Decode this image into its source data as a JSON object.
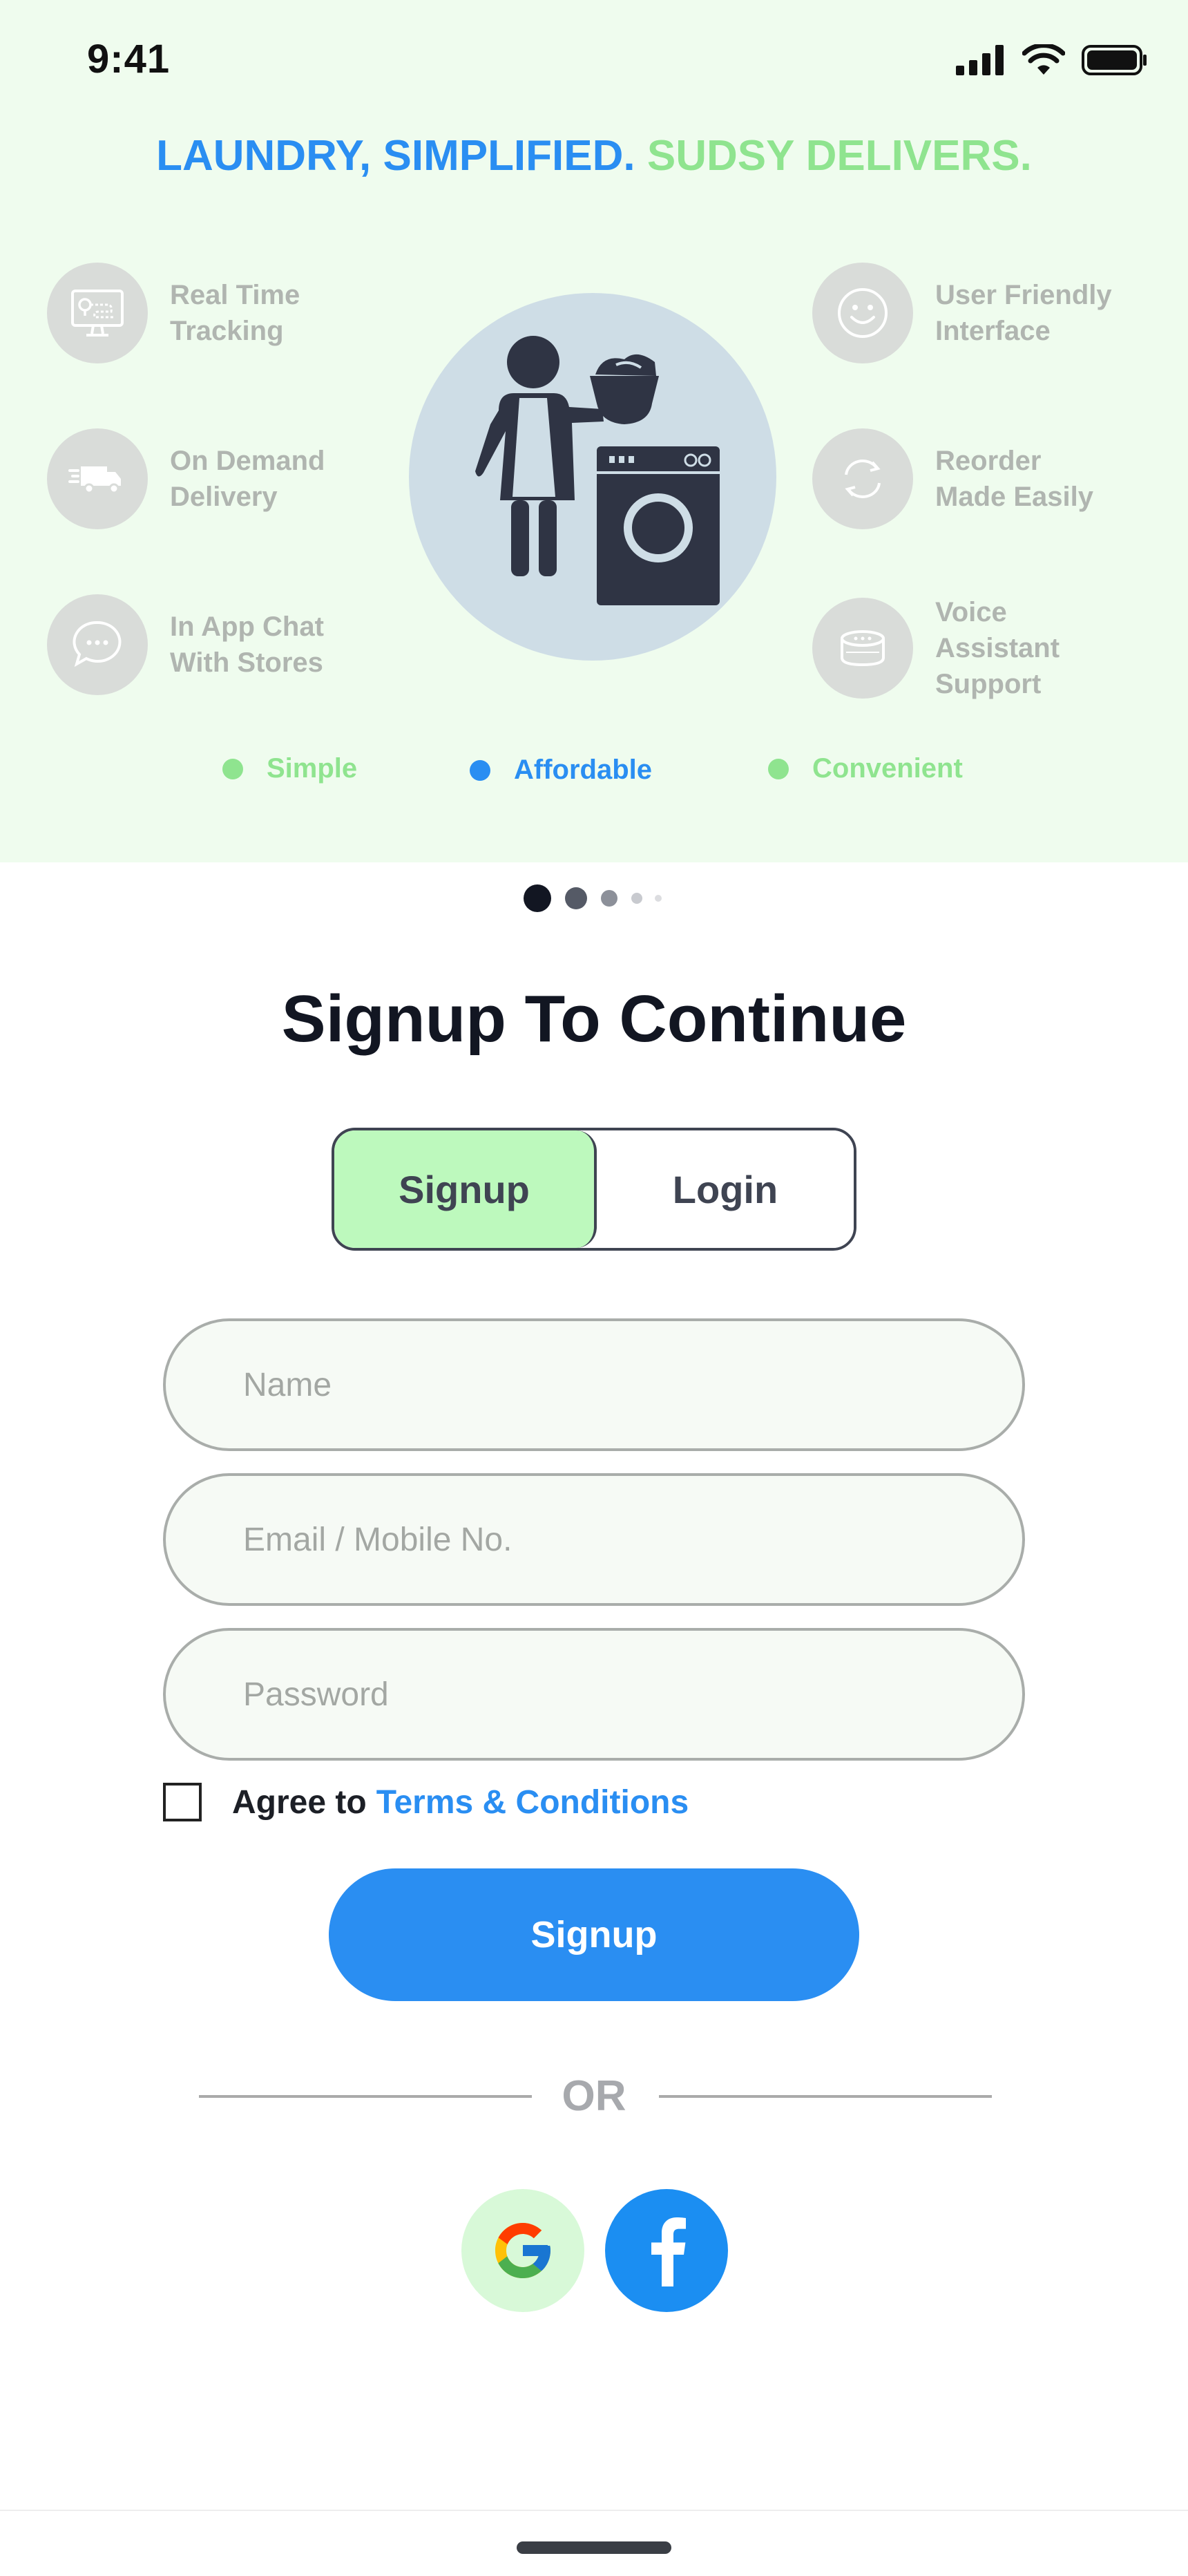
{
  "status_bar": {
    "time": "9:41"
  },
  "hero": {
    "headline_part1": "LAUNDRY, SIMPLIFIED.",
    "headline_part2": "SUDSY DELIVERS.",
    "features_left": [
      {
        "icon": "tracking-monitor-icon",
        "label": "Real Time Tracking"
      },
      {
        "icon": "delivery-truck-icon",
        "label": "On Demand Delivery"
      },
      {
        "icon": "chat-bubble-icon",
        "label": "In App Chat With Stores"
      }
    ],
    "features_right": [
      {
        "icon": "smiley-face-icon",
        "label": "User Friendly Interface"
      },
      {
        "icon": "reorder-cycle-icon",
        "label": "Reorder Made Easily"
      },
      {
        "icon": "smart-speaker-icon",
        "label": "Voice Assistant Support"
      }
    ],
    "chips": [
      {
        "label": "Simple",
        "color": "#8fe48f"
      },
      {
        "label": "Affordable",
        "color": "#2a8ef2"
      },
      {
        "label": "Convenient",
        "color": "#8fe48f"
      }
    ]
  },
  "pager": {
    "count": 5,
    "active_index": 0
  },
  "signup": {
    "title": "Signup To Continue",
    "tabs": {
      "signup": "Signup",
      "login": "Login"
    },
    "fields": {
      "name_placeholder": "Name",
      "email_placeholder": "Email / Mobile No.",
      "password_placeholder": "Password"
    },
    "agree_text": "Agree to",
    "terms_link": "Terms & Conditions",
    "cta": "Signup",
    "or_text": "OR"
  },
  "colors": {
    "accent": "#2a8ef2",
    "brand_green": "#8fe48f",
    "hero_bg": "#effcee",
    "facebook": "#1b8ef2"
  }
}
